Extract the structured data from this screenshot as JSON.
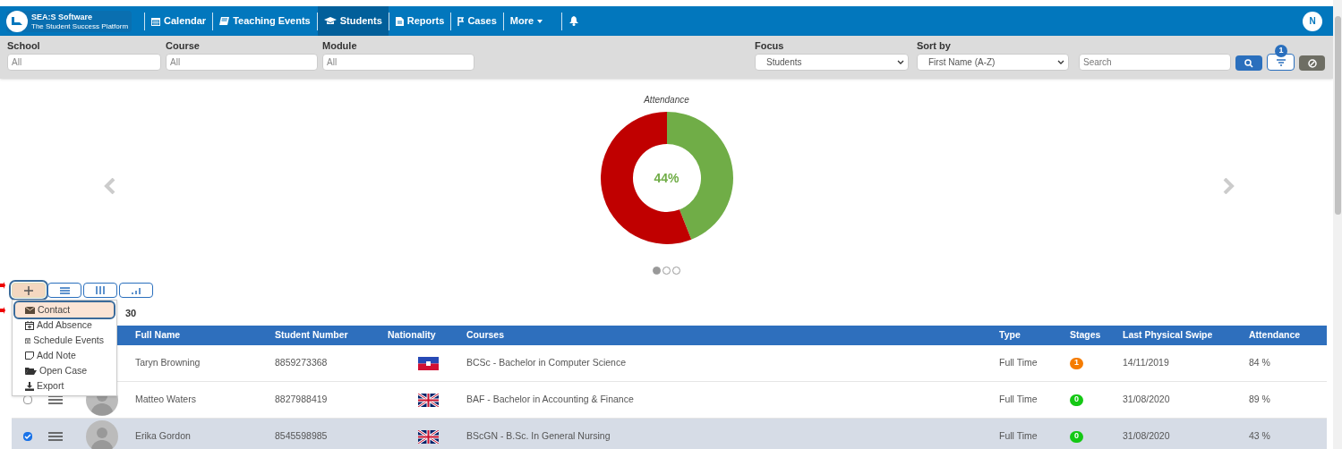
{
  "nav": {
    "logo_title": "SEA:S Software",
    "logo_tagline": "The Student Success Platform",
    "items": [
      {
        "label": "Calendar",
        "selected": false
      },
      {
        "label": "Teaching Events",
        "selected": false
      },
      {
        "label": "Students",
        "selected": true
      },
      {
        "label": "Reports",
        "selected": false
      },
      {
        "label": "Cases",
        "selected": false
      },
      {
        "label": "More",
        "selected": false
      }
    ],
    "user_initial": "N"
  },
  "filters": {
    "school": {
      "label": "School",
      "placeholder": "All"
    },
    "course": {
      "label": "Course",
      "placeholder": "All"
    },
    "module": {
      "label": "Module",
      "placeholder": "All"
    },
    "focus": {
      "label": "Focus",
      "value": "Students"
    },
    "sort_by": {
      "label": "Sort by",
      "value": "First Name (A-Z)"
    },
    "search": {
      "placeholder": "Search"
    },
    "filter_count": "1"
  },
  "carousel": {
    "chart_data": {
      "type": "donut",
      "title": "Attendance",
      "values": [
        44,
        56
      ],
      "colors": [
        "#70ad47",
        "#c00000"
      ],
      "annotations": [
        {
          "text": "44%"
        }
      ]
    },
    "dots": [
      {
        "selected": true
      },
      {
        "selected": false
      },
      {
        "selected": false
      }
    ]
  },
  "toolbar": {
    "buttons": [
      {
        "selected": true
      },
      {
        "selected": false
      },
      {
        "selected": false
      },
      {
        "selected": false
      }
    ]
  },
  "count_text": "30",
  "menu": {
    "items": [
      {
        "label": "Contact",
        "selected": true
      },
      {
        "label": "Add Absence",
        "selected": false
      },
      {
        "label": "Schedule Events",
        "selected": false
      },
      {
        "label": "Add Note",
        "selected": false
      },
      {
        "label": "Open Case",
        "selected": false
      },
      {
        "label": "Export",
        "selected": false
      }
    ]
  },
  "table": {
    "columns": [
      "Full Name",
      "Student Number",
      "Nationality",
      "Courses",
      "Type",
      "Stages",
      "Last Physical Swipe",
      "Attendance"
    ],
    "rows": [
      {
        "selected": false,
        "avatar": false,
        "kind": "haiti",
        "name": "Taryn Browning",
        "number": "8859273368",
        "course": "BCSc - Bachelor in Computer Science",
        "type": "Full Time",
        "stage": "1",
        "color": "#f57c00",
        "swipe": "14/11/2019",
        "attendance": "84 %"
      },
      {
        "selected": false,
        "avatar": true,
        "kind": "uk",
        "name": "Matteo Waters",
        "number": "8827988419",
        "course": "BAF - Bachelor in Accounting & Finance",
        "type": "Full Time",
        "stage": "0",
        "color": "#14c814",
        "swipe": "31/08/2020",
        "attendance": "89 %"
      },
      {
        "selected": true,
        "avatar": true,
        "kind": "uk",
        "name": "Erika Gordon",
        "number": "8545598985",
        "course": "BScGN - B.Sc. In General Nursing",
        "type": "Full Time",
        "stage": "0",
        "color": "#14c814",
        "swipe": "31/08/2020",
        "attendance": "43 %"
      }
    ]
  }
}
